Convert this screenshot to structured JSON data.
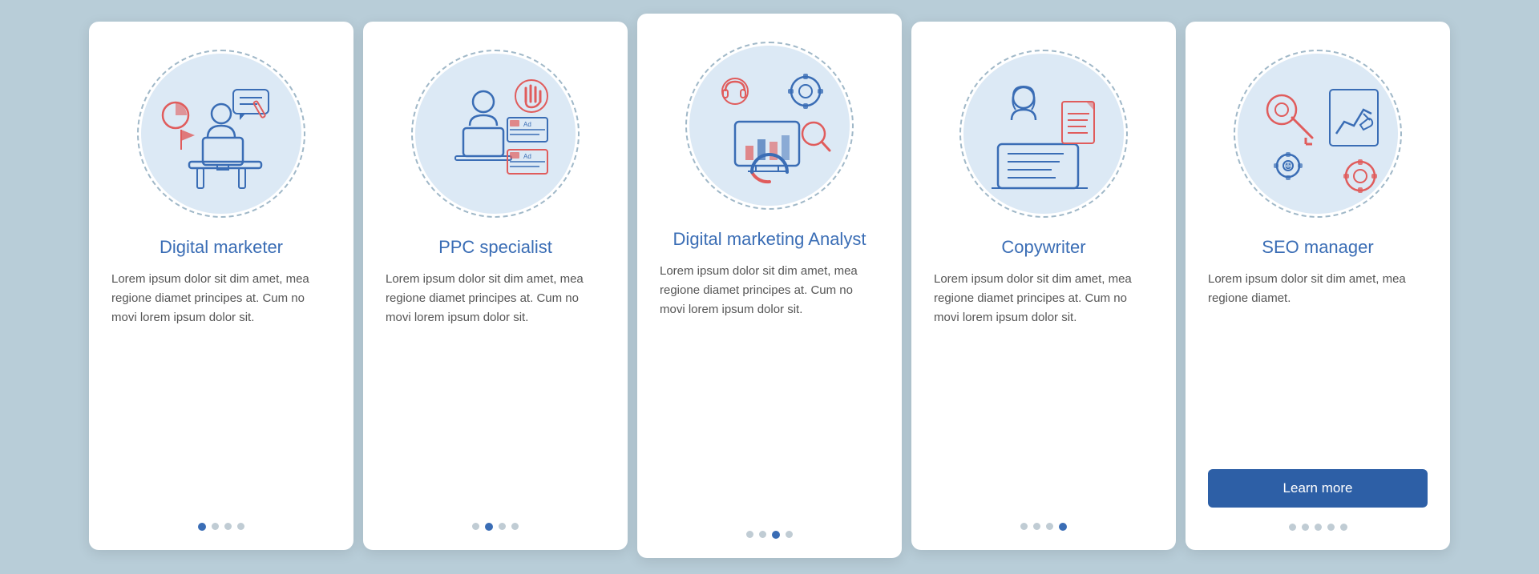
{
  "cards": [
    {
      "id": "digital-marketer",
      "title": "Digital marketer",
      "text": "Lorem ipsum dolor sit dim amet, mea regione diamet principes at. Cum no movi lorem ipsum dolor sit.",
      "dots": [
        true,
        false,
        false,
        false
      ],
      "active_dot": 0,
      "has_button": false
    },
    {
      "id": "ppc-specialist",
      "title": "PPC specialist",
      "text": "Lorem ipsum dolor sit dim amet, mea regione diamet principes at. Cum no movi lorem ipsum dolor sit.",
      "dots": [
        false,
        true,
        false,
        false
      ],
      "active_dot": 1,
      "has_button": false
    },
    {
      "id": "digital-marketing-analyst",
      "title": "Digital marketing Analyst",
      "text": "Lorem ipsum dolor sit dim amet, mea regione diamet principes at. Cum no movi lorem ipsum dolor sit.",
      "dots": [
        false,
        false,
        true,
        false
      ],
      "active_dot": 2,
      "has_button": false
    },
    {
      "id": "copywriter",
      "title": "Copywriter",
      "text": "Lorem ipsum dolor sit dim amet, mea regione diamet principes at. Cum no movi lorem ipsum dolor sit.",
      "dots": [
        false,
        false,
        false,
        true
      ],
      "active_dot": 3,
      "has_button": false
    },
    {
      "id": "seo-manager",
      "title": "SEO manager",
      "text": "Lorem ipsum dolor sit dim amet, mea regione diamet.",
      "dots": [
        false,
        false,
        false,
        false
      ],
      "active_dot": -1,
      "has_button": true,
      "button_label": "Learn more"
    }
  ],
  "colors": {
    "blue": "#3a6db5",
    "red_accent": "#e05c5c",
    "light_blue_bg": "#dce9f5",
    "dot_inactive": "#c0ccd4",
    "dot_active": "#3a6db5"
  }
}
